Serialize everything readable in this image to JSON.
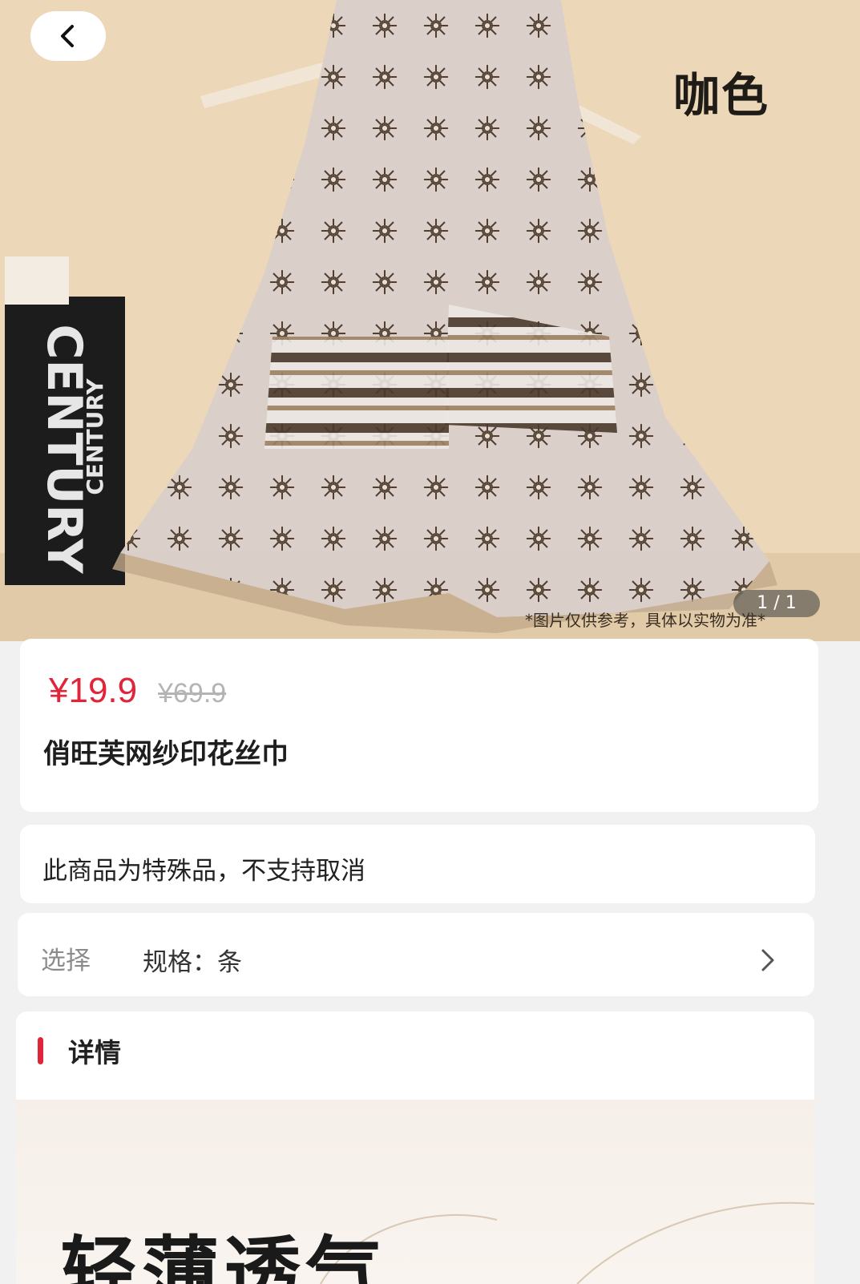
{
  "hero": {
    "color_label": "咖色",
    "counter": "1 / 1",
    "disclaimer": "*图片仅供参考，具体以实物为准*",
    "book_spine_large": "CENTURY",
    "book_spine_small": "CENTURY",
    "back_icon": "chevron-left-icon"
  },
  "product": {
    "price_current": "¥19.9",
    "price_original": "¥69.9",
    "title": "俏旺芙网纱印花丝巾"
  },
  "notice": {
    "text": "此商品为特殊品，不支持取消"
  },
  "select": {
    "label": "选择",
    "value": "规格：条",
    "chevron_icon": "chevron-right-icon"
  },
  "detail": {
    "title": "详情",
    "accent_color": "#e0243a",
    "banner_text": "轻薄透气"
  },
  "colors": {
    "price_red": "#e0243a",
    "muted_grey": "#8b8b8b"
  }
}
